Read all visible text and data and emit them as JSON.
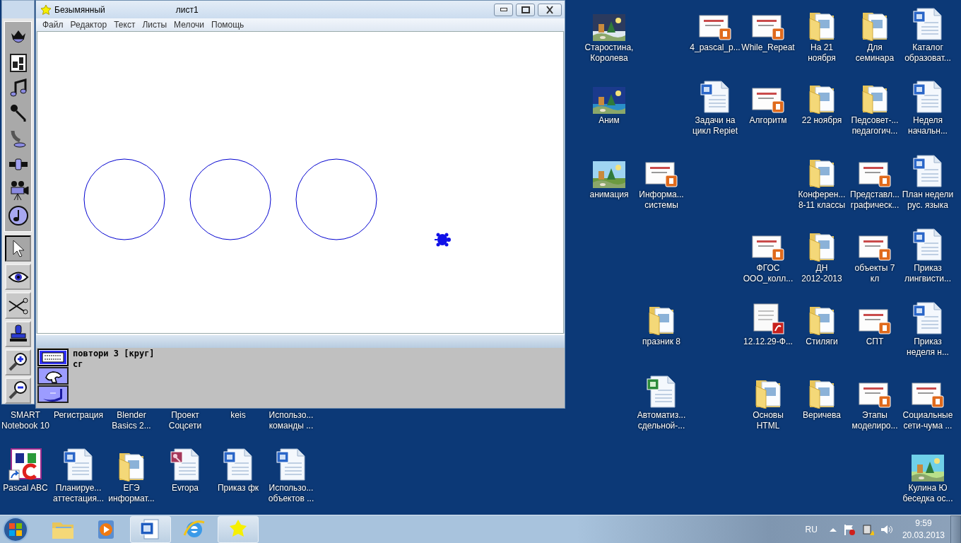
{
  "logo_window": {
    "title": "Безымянный",
    "sheet": "лист1",
    "menu": [
      "Файл",
      "Редактор",
      "Текст",
      "Листы",
      "Мелочи",
      "Помощь"
    ],
    "command_modes": [
      {
        "selected": true
      },
      {
        "selected": false
      },
      {
        "selected": false
      }
    ],
    "command_lines": [
      "повтори 3 [круг]",
      "сг"
    ]
  },
  "tool_buttons": [
    {
      "selected": true
    },
    {
      "selected": false
    },
    {
      "selected": false
    },
    {
      "selected": false
    },
    {
      "selected": false
    },
    {
      "selected": false
    }
  ],
  "desktop_icons": [
    {
      "label": [
        "Старостина,",
        "Королева"
      ],
      "kind": "picture"
    },
    {
      "label": [
        "4_pascal_p..."
      ],
      "kind": "ppt"
    },
    {
      "label": [
        "While_Repeat"
      ],
      "kind": "ppt"
    },
    {
      "label": [
        "На 21",
        "ноября"
      ],
      "kind": "folder"
    },
    {
      "label": [
        "Для",
        "семинара"
      ],
      "kind": "folder"
    },
    {
      "label": [
        "Каталог",
        "образоват..."
      ],
      "kind": "word"
    },
    {
      "label": [
        "Аним"
      ],
      "kind": "picture"
    },
    {
      "label": [
        "Задачи на",
        "цикл Repiet"
      ],
      "kind": "word"
    },
    {
      "label": [
        "Алгоритм"
      ],
      "kind": "ppt"
    },
    {
      "label": [
        "22 ноября"
      ],
      "kind": "folder"
    },
    {
      "label": [
        "Педсовет-...",
        "педагогич..."
      ],
      "kind": "folder"
    },
    {
      "label": [
        "Неделя",
        "начальн..."
      ],
      "kind": "word"
    },
    {
      "label": [
        "анимация"
      ],
      "kind": "picture"
    },
    {
      "label": [
        "Информа...",
        "системы"
      ],
      "kind": "ppt"
    },
    {
      "label": [
        "Конферен...",
        "8-11 классы"
      ],
      "kind": "folder"
    },
    {
      "label": [
        "Представл...",
        "графическ..."
      ],
      "kind": "ppt"
    },
    {
      "label": [
        "План недели",
        "рус. языка"
      ],
      "kind": "word"
    },
    {
      "label": [
        "ФГОС",
        "ООО_колл..."
      ],
      "kind": "ppt"
    },
    {
      "label": [
        "ДН",
        "2012-2013"
      ],
      "kind": "folder"
    },
    {
      "label": [
        "объекты 7",
        "кл"
      ],
      "kind": "ppt"
    },
    {
      "label": [
        "Приказ",
        "лингвисти..."
      ],
      "kind": "word"
    },
    {
      "label": [
        "празник 8"
      ],
      "kind": "folder"
    },
    {
      "label": [
        "12.12.29-Ф..."
      ],
      "kind": "pdf"
    },
    {
      "label": [
        "Стиляги"
      ],
      "kind": "folder"
    },
    {
      "label": [
        "СПТ"
      ],
      "kind": "ppt"
    },
    {
      "label": [
        "Приказ",
        "неделя н..."
      ],
      "kind": "word"
    },
    {
      "label": [
        "SMART",
        "Notebook 10"
      ]
    },
    {
      "label": [
        "Регистрация"
      ]
    },
    {
      "label": [
        "Blender",
        "Basics 2..."
      ]
    },
    {
      "label": [
        "Проект",
        "Соцсети"
      ]
    },
    {
      "label": [
        "keis"
      ]
    },
    {
      "label": [
        "Использо...",
        "команды ..."
      ]
    },
    {
      "label": [
        "Автоматиз...",
        "сдельной-..."
      ],
      "kind": "excel"
    },
    {
      "label": [
        "Основы",
        "HTML"
      ],
      "kind": "folder"
    },
    {
      "label": [
        "Веричева"
      ],
      "kind": "folder"
    },
    {
      "label": [
        "Этапы",
        "моделиро..."
      ],
      "kind": "ppt"
    },
    {
      "label": [
        "Социальные",
        "сети-чума ..."
      ],
      "kind": "ppt"
    },
    {
      "label": [
        "Pascal ABC"
      ],
      "kind": "pascal"
    },
    {
      "label": [
        "Планируе...",
        "аттестация..."
      ],
      "kind": "word"
    },
    {
      "label": [
        "ЕГЭ",
        "информат..."
      ],
      "kind": "folder"
    },
    {
      "label": [
        "Evropa"
      ],
      "kind": "access"
    },
    {
      "label": [
        "Приказ фк"
      ],
      "kind": "word"
    },
    {
      "label": [
        "Использо...",
        "объектов ..."
      ],
      "kind": "word"
    },
    {
      "label": [
        "Кулина Ю",
        "беседка ос..."
      ],
      "kind": "picture"
    }
  ],
  "taskbar": {
    "items": [
      {
        "kind": "explorer",
        "running": false
      },
      {
        "kind": "media",
        "running": false
      },
      {
        "kind": "word",
        "running": true
      },
      {
        "kind": "ie",
        "running": false
      },
      {
        "kind": "logo",
        "running": true
      }
    ],
    "language": "RU",
    "time": "9:59",
    "date": "20.03.2013"
  }
}
